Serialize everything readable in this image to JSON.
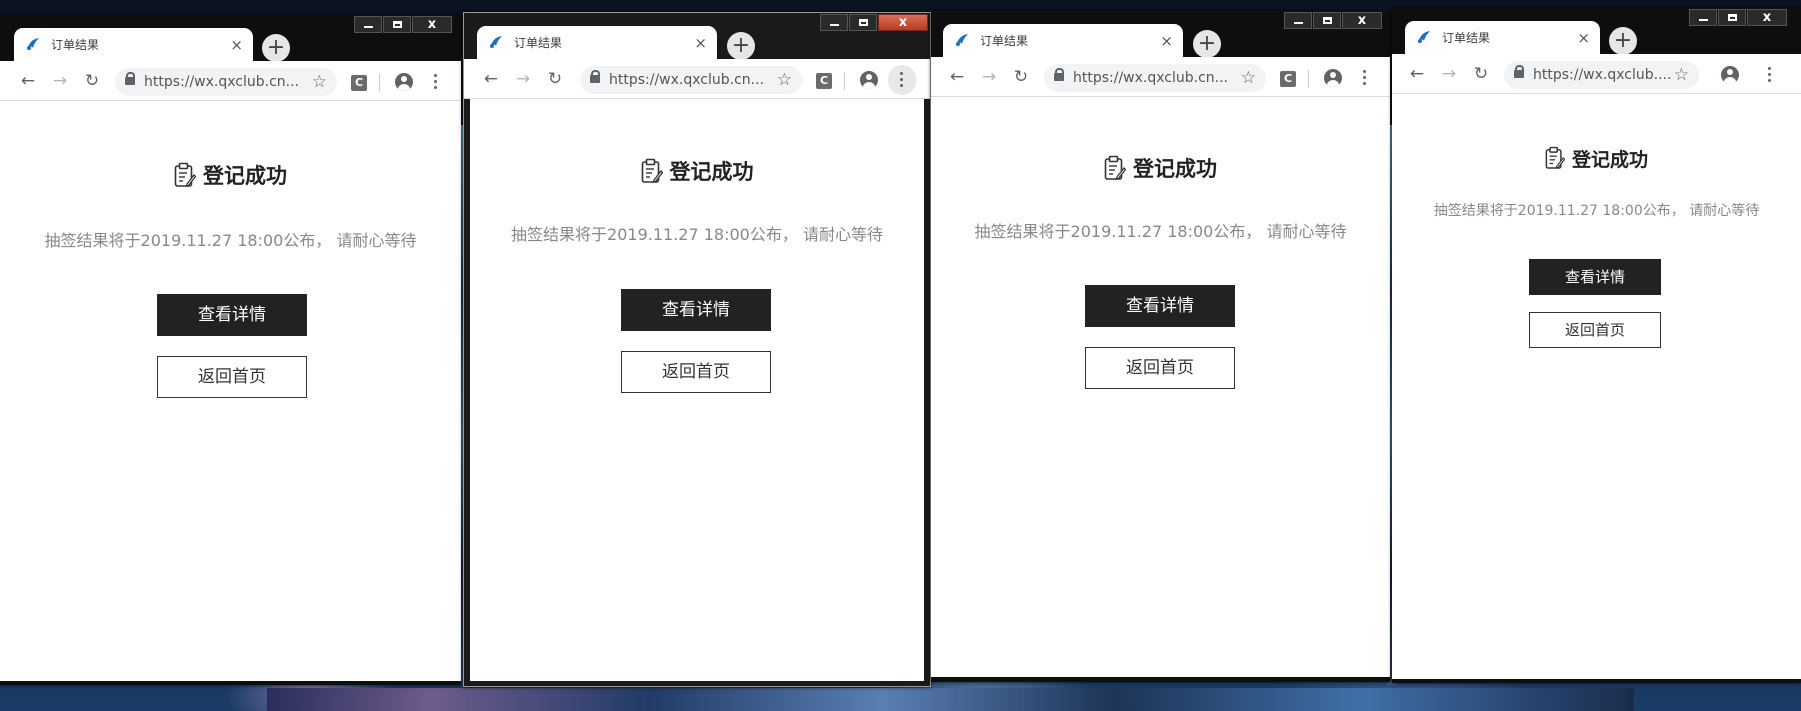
{
  "desktop": {
    "wallpaper_name": "anime-night-sky-wallpaper"
  },
  "window_controls": {
    "minimize_icon": "minimize-icon",
    "maximize_icon": "maximize-icon",
    "close_label": "x"
  },
  "browser": {
    "tab_title": "订单结果",
    "tab_close": "×",
    "new_tab": "+",
    "url_full": "https://wx.qxclub.cn...",
    "url_short": "https://wx.qxclub....",
    "ext_label": "C",
    "icons": {
      "back": "back-arrow-icon",
      "forward": "forward-arrow-icon",
      "reload": "reload-icon",
      "lock": "lock-icon",
      "star": "bookmark-star-icon",
      "profile": "profile-icon",
      "menu": "kebab-menu-icon"
    }
  },
  "page": {
    "title": "登记成功",
    "message": "抽签结果将于2019.11.27 18:00公布， 请耐心等待",
    "view_details": "查看详情",
    "return_home": "返回首页",
    "title_icon": "clipboard-icon"
  },
  "colors": {
    "primary_button": "#222222",
    "message_text": "#888888",
    "favicon_blue": "#1f6fc4"
  }
}
